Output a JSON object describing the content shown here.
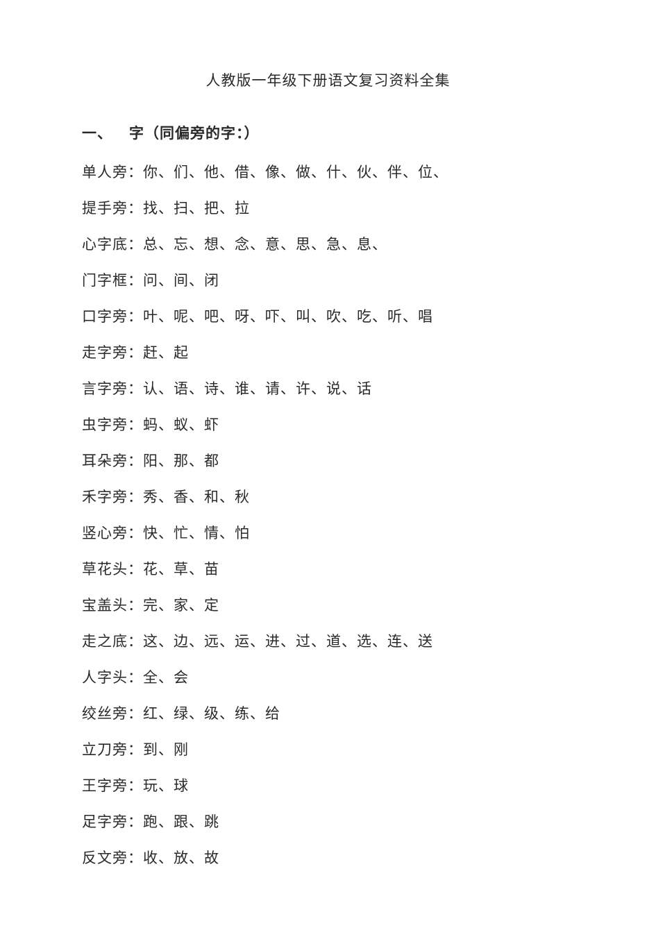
{
  "title": "人教版一年级下册语文复习资料全集",
  "section": {
    "number": "一、",
    "heading": "字（同偏旁的字：）"
  },
  "sep": "、",
  "lines": [
    {
      "label": "单人旁：",
      "chars": [
        "你",
        "们",
        "他",
        "借",
        "像",
        "做",
        "什",
        "伙",
        "伴",
        "位"
      ],
      "trail": true
    },
    {
      "label": "提手旁：",
      "chars": [
        "找",
        "扫",
        "把",
        "拉"
      ],
      "trail": false
    },
    {
      "label": "心字底：",
      "chars": [
        "总",
        "忘",
        "想",
        "念",
        "意",
        "思",
        "急",
        "息"
      ],
      "trail": true
    },
    {
      "label": "门字框：",
      "chars": [
        "问",
        "间",
        "闭"
      ],
      "trail": false
    },
    {
      "label": "口字旁：",
      "chars": [
        "叶",
        "呢",
        "吧",
        "呀",
        "吓",
        "叫",
        "吹",
        "吃",
        "听",
        "唱"
      ],
      "trail": false
    },
    {
      "label": "走字旁：",
      "chars": [
        "赶",
        "起"
      ],
      "trail": false
    },
    {
      "label": "言字旁：",
      "chars": [
        "认",
        "语",
        "诗",
        "谁",
        "请",
        "许",
        "说",
        "话"
      ],
      "trail": false
    },
    {
      "label": "虫字旁：",
      "chars": [
        "蚂",
        "蚁",
        "虾"
      ],
      "trail": false
    },
    {
      "label": "耳朵旁：",
      "chars": [
        "阳",
        "那",
        "都"
      ],
      "trail": false
    },
    {
      "label": "禾字旁：",
      "chars": [
        "秀",
        "香",
        "和",
        "秋"
      ],
      "trail": false
    },
    {
      "label": "竖心旁：",
      "chars": [
        "快",
        "忙",
        "情",
        "怕"
      ],
      "trail": false
    },
    {
      "label": "草花头：",
      "chars": [
        "花",
        "草",
        "苗"
      ],
      "trail": false
    },
    {
      "label": "宝盖头：",
      "chars": [
        "完",
        "家",
        "定"
      ],
      "trail": false
    },
    {
      "label": "走之底：",
      "chars": [
        "这",
        "边",
        "远",
        "运",
        "进",
        "过",
        "道",
        "选",
        "连",
        "送"
      ],
      "trail": false
    },
    {
      "label": "人字头：",
      "chars": [
        "全",
        "会"
      ],
      "trail": false
    },
    {
      "label": "绞丝旁：",
      "chars": [
        "红",
        "绿",
        "级",
        "练",
        "给"
      ],
      "trail": false
    },
    {
      "label": "立刀旁：",
      "chars": [
        "到",
        "刚"
      ],
      "trail": false
    },
    {
      "label": "王字旁：",
      "chars": [
        "玩",
        "球"
      ],
      "trail": false
    },
    {
      "label": "足字旁：",
      "chars": [
        "跑",
        "跟",
        "跳"
      ],
      "trail": false
    },
    {
      "label": "反文旁：",
      "chars": [
        "收",
        "放",
        "故"
      ],
      "trail": false
    }
  ]
}
